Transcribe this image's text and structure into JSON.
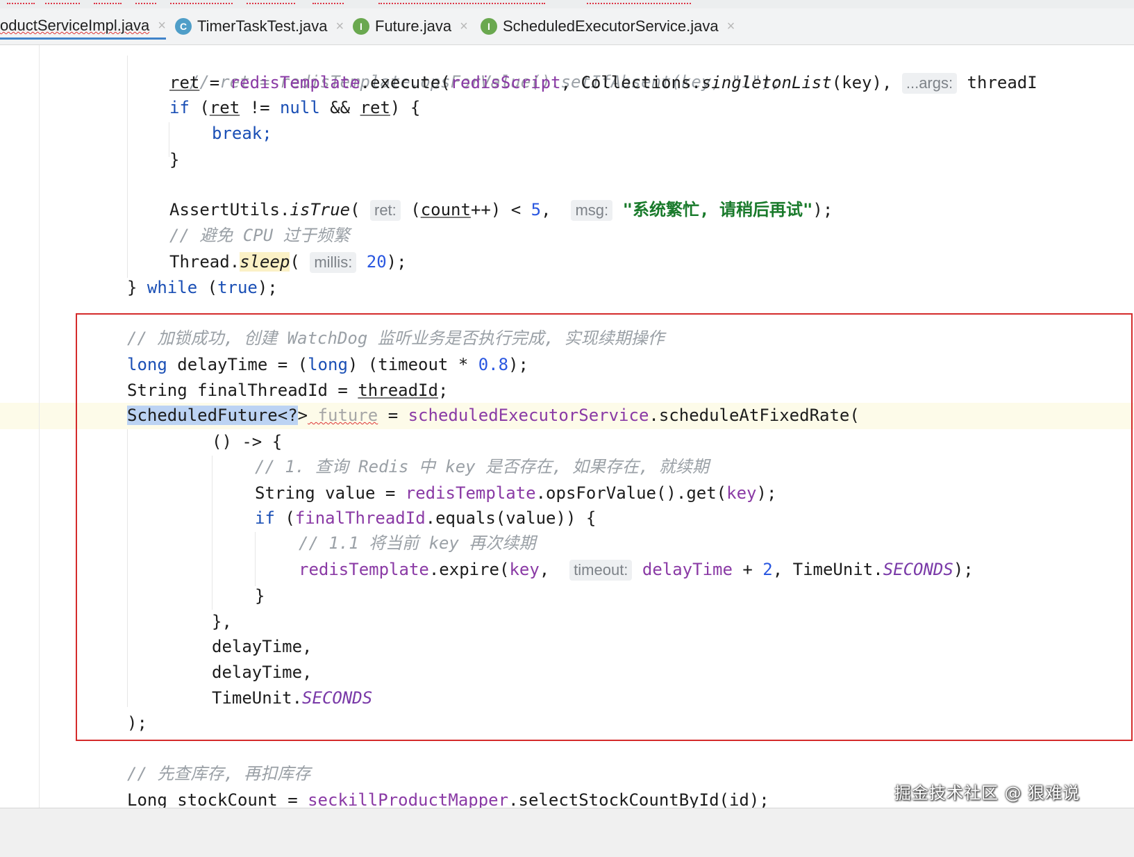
{
  "tabs": [
    {
      "label": "oductServiceImpl.java",
      "active": true,
      "icon": ""
    },
    {
      "label": "TimerTaskTest.java",
      "active": false,
      "icon": "class-icon"
    },
    {
      "label": "Future.java",
      "active": false,
      "icon": "interface-icon"
    },
    {
      "label": "ScheduledExecutorService.java",
      "active": false,
      "icon": "interface-icon"
    }
  ],
  "tab_close_glyph": "×",
  "icon_letters": {
    "class": "C",
    "interface": "I"
  },
  "code": {
    "l1": "// ret = redisTemplate.opsForValue().setIfAbsent(key, \"1\");",
    "l2_a": "ret",
    "l2_b": " = ",
    "l2_c": "redisTemplate",
    "l2_d": ".execute(",
    "l2_e": "redisScript",
    "l2_f": ", Collections.",
    "l2_g": "singletonList",
    "l2_h": "(key), ",
    "l2_hint": "...args:",
    "l2_i": " threadI",
    "l3_if": "if",
    "l3_a": " (",
    "l3_ret1": "ret",
    "l3_b": " != ",
    "l3_null": "null",
    "l3_c": " && ",
    "l3_ret2": "ret",
    "l3_d": ") {",
    "l4": "break;",
    "l5": "}",
    "l6_a": "AssertUtils.",
    "l6_b": "isTrue",
    "l6_c": "( ",
    "l6_hint1": "ret:",
    "l6_d": " (",
    "l6_e": "count",
    "l6_f": "++) < ",
    "l6_num": "5",
    "l6_g": ",  ",
    "l6_hint2": "msg:",
    "l6_str": " \"系统繁忙, 请稍后再试\"",
    "l6_h": ");",
    "l7": "// 避免 CPU 过于频繁",
    "l8_a": "Thread.",
    "l8_b": "sleep",
    "l8_c": "( ",
    "l8_hint": "millis:",
    "l8_num": " 20",
    "l8_d": ");",
    "l9_a": "} ",
    "l9_while": "while",
    "l9_b": " (",
    "l9_true": "true",
    "l9_c": ");",
    "b1": "// 加锁成功, 创建 WatchDog 监听业务是否执行完成, 实现续期操作",
    "b2_long1": "long",
    "b2_a": " delayTime = (",
    "b2_long2": "long",
    "b2_b": ") (timeout * ",
    "b2_num": "0.8",
    "b2_c": ");",
    "b3_a": "String finalThreadId = ",
    "b3_b": "threadId",
    "b3_c": ";",
    "b4_a": "ScheduledFuture<?",
    "b4_b": ">",
    "b4_c": " future",
    "b4_d": " = ",
    "b4_e": "scheduledExecutorService",
    "b4_f": ".scheduleAtFixedRate(",
    "b5": "() -> {",
    "b6": "// 1. 查询 Redis 中 key 是否存在, 如果存在, 就续期",
    "b7_a": "String value = ",
    "b7_b": "redisTemplate",
    "b7_c": ".opsForValue().get(",
    "b7_d": "key",
    "b7_e": ");",
    "b8_if": "if",
    "b8_a": " (",
    "b8_b": "finalThreadId",
    "b8_c": ".equals(value)) {",
    "b9": "// 1.1 将当前 key 再次续期",
    "b10_a": "redisTemplate",
    "b10_b": ".expire(",
    "b10_c": "key",
    "b10_d": ",  ",
    "b10_hint": "timeout:",
    "b10_e": " delayTime",
    "b10_f": " + ",
    "b10_num": "2",
    "b10_g": ", TimeUnit.",
    "b10_h": "SECONDS",
    "b10_i": ");",
    "b11": "}",
    "b12": "},",
    "b13": "delayTime,",
    "b14": "delayTime,",
    "b15_a": "TimeUnit.",
    "b15_b": "SECONDS",
    "b16": ");",
    "c1": "// 先查库存, 再扣库存",
    "c2_a": "Long stockCount = ",
    "c2_b": "seckillProductMapper",
    "c2_c": ".selectStockCountById(id);"
  },
  "watermark": "掘金技术社区 @ 狠难说",
  "colors": {
    "highlight_box": "#d42a2a",
    "selection": "#bcd3f3",
    "keyword": "#1a4fb5",
    "field": "#8a3aa5"
  }
}
